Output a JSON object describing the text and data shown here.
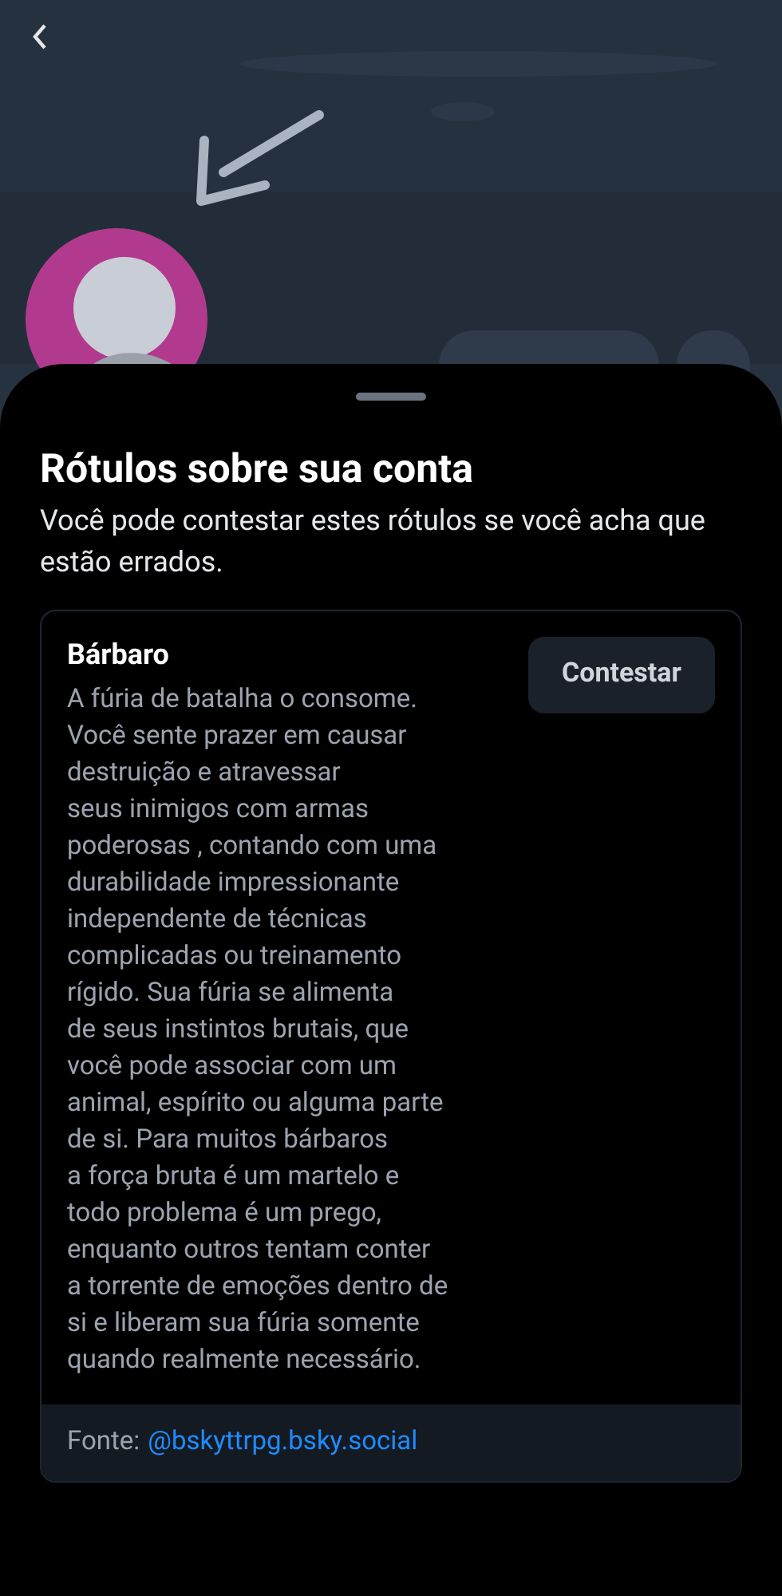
{
  "sheet": {
    "title": "Rótulos sobre sua conta",
    "subtitle": "Você pode contestar estes rótulos se você acha que estão errados."
  },
  "labels": [
    {
      "name": "Bárbaro",
      "description": "A fúria de batalha o consome.\nVocê sente prazer em causar\ndestruição e atravessar\nseus inimigos com armas\npoderosas , contando com uma\ndurabilidade impressionante\nindependente de técnicas\ncomplicadas ou treinamento\nrígido. Sua fúria se alimenta\nde seus instintos brutais, que\nvocê pode associar com um\nanimal, espírito ou alguma parte\nde si. Para muitos bárbaros\na força bruta é um martelo e\ntodo problema é um prego,\nenquanto outros tentam conter\na torrente de emoções dentro de\nsi e liberam sua fúria somente\nquando realmente necessário.",
      "action": "Contestar",
      "source_label": "Fonte:",
      "source_handle": "@bskyttrpg.bsky.social"
    }
  ]
}
